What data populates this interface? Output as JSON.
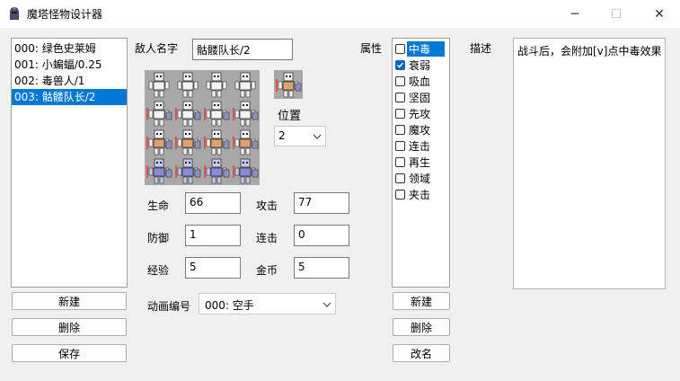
{
  "window": {
    "title": "魔塔怪物设计器",
    "icon": "knight-helmet-icon",
    "minimize_icon": "─",
    "maximize_icon": "☐",
    "close_icon": "✕"
  },
  "monster_list": {
    "items": [
      {
        "label": "000: 绿色史莱姆"
      },
      {
        "label": "001: 小蝙蝠/0.25"
      },
      {
        "label": "002: 毒兽人/1"
      },
      {
        "label": "003: 骷髅队长/2"
      }
    ],
    "selected_index": 3,
    "new_button": "新建",
    "delete_button": "删除",
    "save_button": "保存"
  },
  "enemy_name": {
    "label": "敌人名字",
    "value": "骷髅队长/2"
  },
  "position": {
    "label": "位置",
    "value": "2"
  },
  "stats": {
    "hp_label": "生命",
    "hp_value": "66",
    "atk_label": "攻击",
    "atk_value": "77",
    "def_label": "防御",
    "def_value": "1",
    "combo_label": "连击",
    "combo_value": "0",
    "exp_label": "经验",
    "exp_value": "5",
    "gold_label": "金币",
    "gold_value": "5"
  },
  "animation": {
    "label": "动画编号",
    "value": "000: 空手"
  },
  "attributes": {
    "label": "属性",
    "items": [
      {
        "label": "中毒",
        "checked": false,
        "selected": true
      },
      {
        "label": "衰弱",
        "checked": true,
        "selected": false
      },
      {
        "label": "吸血",
        "checked": false,
        "selected": false
      },
      {
        "label": "坚固",
        "checked": false,
        "selected": false
      },
      {
        "label": "先攻",
        "checked": false,
        "selected": false
      },
      {
        "label": "魔攻",
        "checked": false,
        "selected": false
      },
      {
        "label": "连击",
        "checked": false,
        "selected": false
      },
      {
        "label": "再生",
        "checked": false,
        "selected": false
      },
      {
        "label": "领域",
        "checked": false,
        "selected": false
      },
      {
        "label": "夹击",
        "checked": false,
        "selected": false
      }
    ],
    "new_button": "新建",
    "delete_button": "删除",
    "rename_button": "改名"
  },
  "description": {
    "label": "描述",
    "value": "战斗后，会附加[v]点中毒效果"
  },
  "colors": {
    "selection": "#0078d7",
    "checkbox": "#0067c0",
    "sprite_bg": "#a8a8a8"
  }
}
